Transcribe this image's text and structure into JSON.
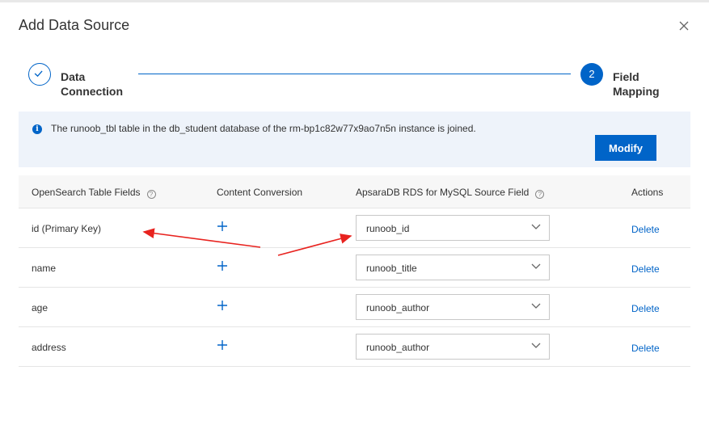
{
  "dialog": {
    "title": "Add Data Source"
  },
  "steps": [
    {
      "label_line1": "Data",
      "label_line2": "Connection",
      "status": "done"
    },
    {
      "number": "2",
      "label_line1": "Field",
      "label_line2": "Mapping",
      "status": "active"
    }
  ],
  "banner": {
    "message": "The runoob_tbl table in the db_student database of the rm-bp1c82w77x9ao7n5n instance is joined.",
    "modify_label": "Modify"
  },
  "table": {
    "headers": {
      "field": "OpenSearch Table Fields",
      "conversion": "Content Conversion",
      "source": "ApsaraDB RDS for MySQL Source Field",
      "actions": "Actions"
    },
    "rows": [
      {
        "field": "id (Primary Key)",
        "source": "runoob_id",
        "action": "Delete"
      },
      {
        "field": "name",
        "source": "runoob_title",
        "action": "Delete"
      },
      {
        "field": "age",
        "source": "runoob_author",
        "action": "Delete"
      },
      {
        "field": "address",
        "source": "runoob_author",
        "action": "Delete"
      }
    ]
  },
  "colors": {
    "accent": "#0064c8",
    "banner_bg": "#eef3fa",
    "annotation_arrow": "#e8231f"
  },
  "icons": [
    "close-icon",
    "check-icon",
    "info-icon",
    "help-icon",
    "plus-icon",
    "chevron-down-icon"
  ]
}
